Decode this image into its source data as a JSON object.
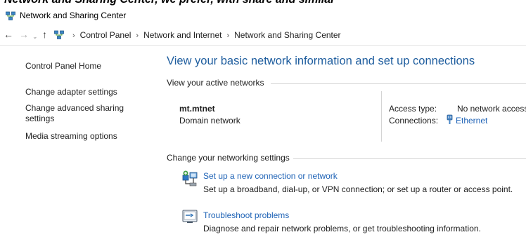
{
  "top_caption": "Network and Sharing Center, we prefer, with share and similar",
  "window": {
    "title": "Network and Sharing Center"
  },
  "nav": {
    "back": "←",
    "forward": "→",
    "recent": "⌄",
    "up": "↑",
    "breadcrumb": [
      "Control Panel",
      "Network and Internet",
      "Network and Sharing Center"
    ],
    "separator": "›"
  },
  "sidebar": {
    "items": [
      "Control Panel Home",
      "Change adapter settings",
      "Change advanced sharing\nsettings",
      "Media streaming options"
    ]
  },
  "main": {
    "heading": "View your basic network information and set up connections",
    "active_section": "View your active networks",
    "network": {
      "name": "mt.mtnet",
      "type": "Domain network",
      "access_label": "Access type:",
      "access_value": "No network access",
      "connections_label": "Connections:",
      "connection_name": "Ethernet"
    },
    "change_section": "Change your networking settings",
    "tasks": [
      {
        "link": "Set up a new connection or network",
        "desc": "Set up a broadband, dial-up, or VPN connection; or set up a router or access point.",
        "icon": "new-connection-icon"
      },
      {
        "link": "Troubleshoot problems",
        "desc": "Diagnose and repair network problems, or get troubleshooting information.",
        "icon": "troubleshoot-icon"
      }
    ]
  },
  "colors": {
    "heading": "#1e5d9e",
    "link": "#1f63b6",
    "rule": "#d4d4d4"
  }
}
